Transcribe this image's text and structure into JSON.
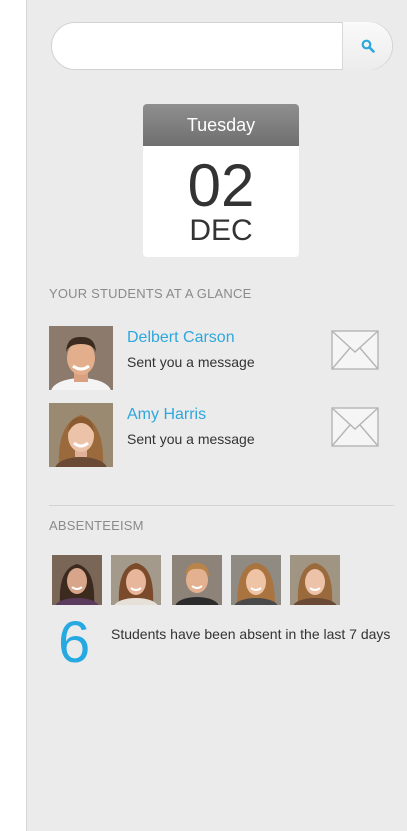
{
  "search": {
    "placeholder": ""
  },
  "calendar": {
    "weekday": "Tuesday",
    "day": "02",
    "month": "DEC"
  },
  "glance": {
    "title": "YOUR STUDENTS AT A GLANCE",
    "students": [
      {
        "name": "Delbert Carson",
        "status": "Sent you a message"
      },
      {
        "name": "Amy Harris",
        "status": "Sent you a message"
      }
    ]
  },
  "absenteeism": {
    "title": "ABSENTEEISM",
    "count": "6",
    "description": "Students have been absent in the last 7 days"
  },
  "colors": {
    "accent": "#25a9e0",
    "panel": "#ebebeb",
    "calendar_header": "#7f7f7f"
  },
  "icons": [
    "search-icon",
    "envelope-icon"
  ]
}
